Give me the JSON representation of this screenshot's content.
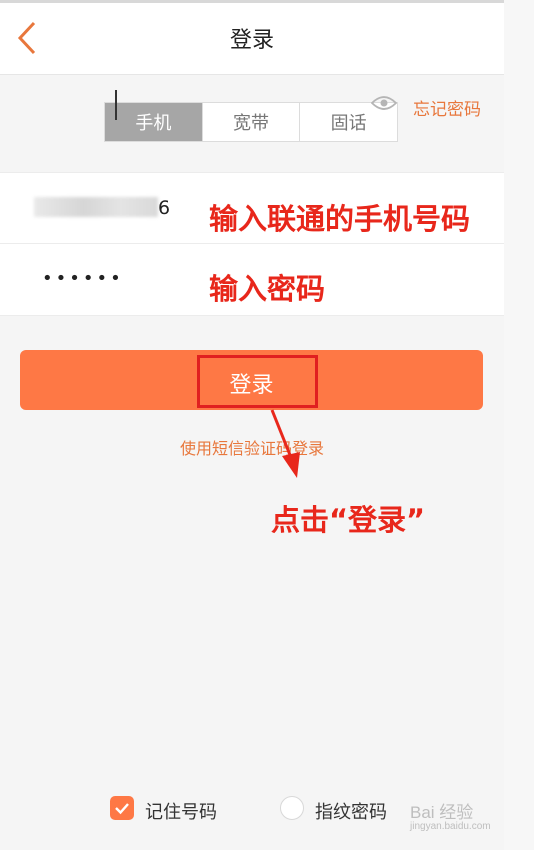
{
  "header": {
    "title": "登录",
    "back_icon": "chevron-left-icon",
    "back_color": "#e8773c"
  },
  "tabs": [
    {
      "label": "手机",
      "active": true
    },
    {
      "label": "宽带",
      "active": false
    },
    {
      "label": "固话",
      "active": false
    }
  ],
  "form": {
    "phone_value_visible": "6",
    "password_dots": "••••••",
    "eye_icon": "eye-icon",
    "forgot_label": "忘记密码"
  },
  "login_button": {
    "label": "登录",
    "color": "#fe7845"
  },
  "sms_login_link": "使用短信验证码登录",
  "annotations": {
    "phone": "输入联通的手机号码",
    "password": "输入密码",
    "click": "点击“登录”",
    "color": "#e8271b"
  },
  "options": {
    "remember_number": {
      "label": "记住号码",
      "checked": true
    },
    "fingerprint": {
      "label": "指纹密码",
      "checked": false
    }
  },
  "watermark": {
    "text": "Bai 经验",
    "sub": "jingyan.baidu.com"
  }
}
